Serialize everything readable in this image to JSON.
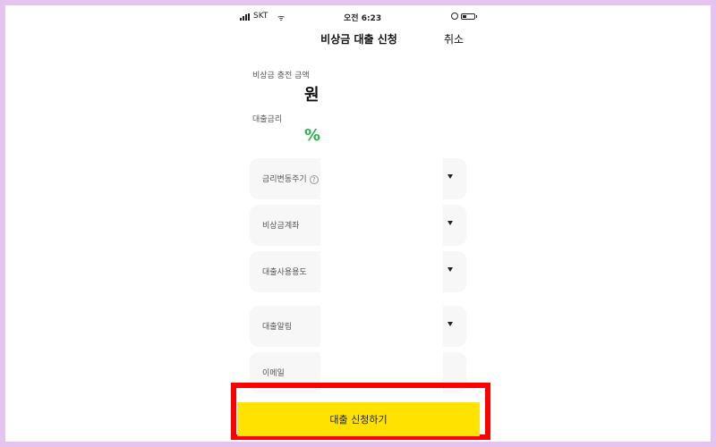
{
  "status_bar": {
    "carrier": "SKT",
    "time": "오전 6:23"
  },
  "header": {
    "title": "비상금 대출 신청",
    "cancel_label": "취소"
  },
  "amount": {
    "label": "비상금 충전 금액",
    "unit": "원"
  },
  "rate": {
    "label": "대출금리",
    "unit": "%",
    "color": "#2bb24c"
  },
  "fields": [
    {
      "label": "금리변동주기",
      "has_help_icon": true
    },
    {
      "label": "비상금계좌"
    },
    {
      "label": "대출사용용도"
    },
    {
      "label": "대출알림"
    },
    {
      "label": "이메일"
    }
  ],
  "submit": {
    "label": "대출 신청하기",
    "color": "#ffe200"
  },
  "highlight_color": "#ff0000",
  "icons": [
    "signal-icon",
    "wifi-icon",
    "lock-rotation-icon",
    "battery-icon",
    "help-icon",
    "dropdown-caret-icon"
  ]
}
